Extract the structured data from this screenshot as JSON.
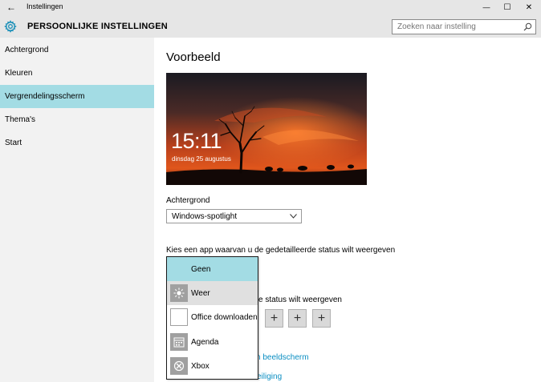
{
  "window": {
    "title": "Instellingen",
    "back_glyph": "←",
    "minimize_glyph": "—",
    "maximize_glyph": "☐",
    "close_glyph": "✕"
  },
  "header": {
    "title": "PERSOONLIJKE INSTELLINGEN",
    "search_placeholder": "Zoeken naar instelling"
  },
  "sidebar": {
    "items": [
      {
        "label": "Achtergrond"
      },
      {
        "label": "Kleuren"
      },
      {
        "label": "Vergrendelingsscherm",
        "active": true
      },
      {
        "label": "Thema's"
      },
      {
        "label": "Start"
      }
    ]
  },
  "main": {
    "preview_title": "Voorbeeld",
    "preview_time": "15:11",
    "preview_date": "dinsdag 25 augustus",
    "background_label": "Achtergrond",
    "background_value": "Windows-spotlight",
    "detailed_status_label": "Kies een app waarvan u de gedetailleerde status wilt weergeven",
    "quick_status_label_visible": "e status wilt weergeven",
    "plus_glyph": "+",
    "link1_visible": "n beeldscherm",
    "link2_visible": "eiliging"
  },
  "dropdown": {
    "options": [
      {
        "label": "Geen",
        "icon": "none",
        "selected": true
      },
      {
        "label": "Weer",
        "icon": "weather-sun-icon"
      },
      {
        "label": "Office downloaden",
        "icon": "office-tile-icon"
      },
      {
        "label": "Agenda",
        "icon": "calendar-icon"
      },
      {
        "label": "Xbox",
        "icon": "xbox-icon"
      }
    ]
  },
  "colors": {
    "accent": "#a3dce4",
    "link": "#0a8ec2",
    "titlebar": "#e6e6e6",
    "sidebar": "#f2f2f2"
  }
}
